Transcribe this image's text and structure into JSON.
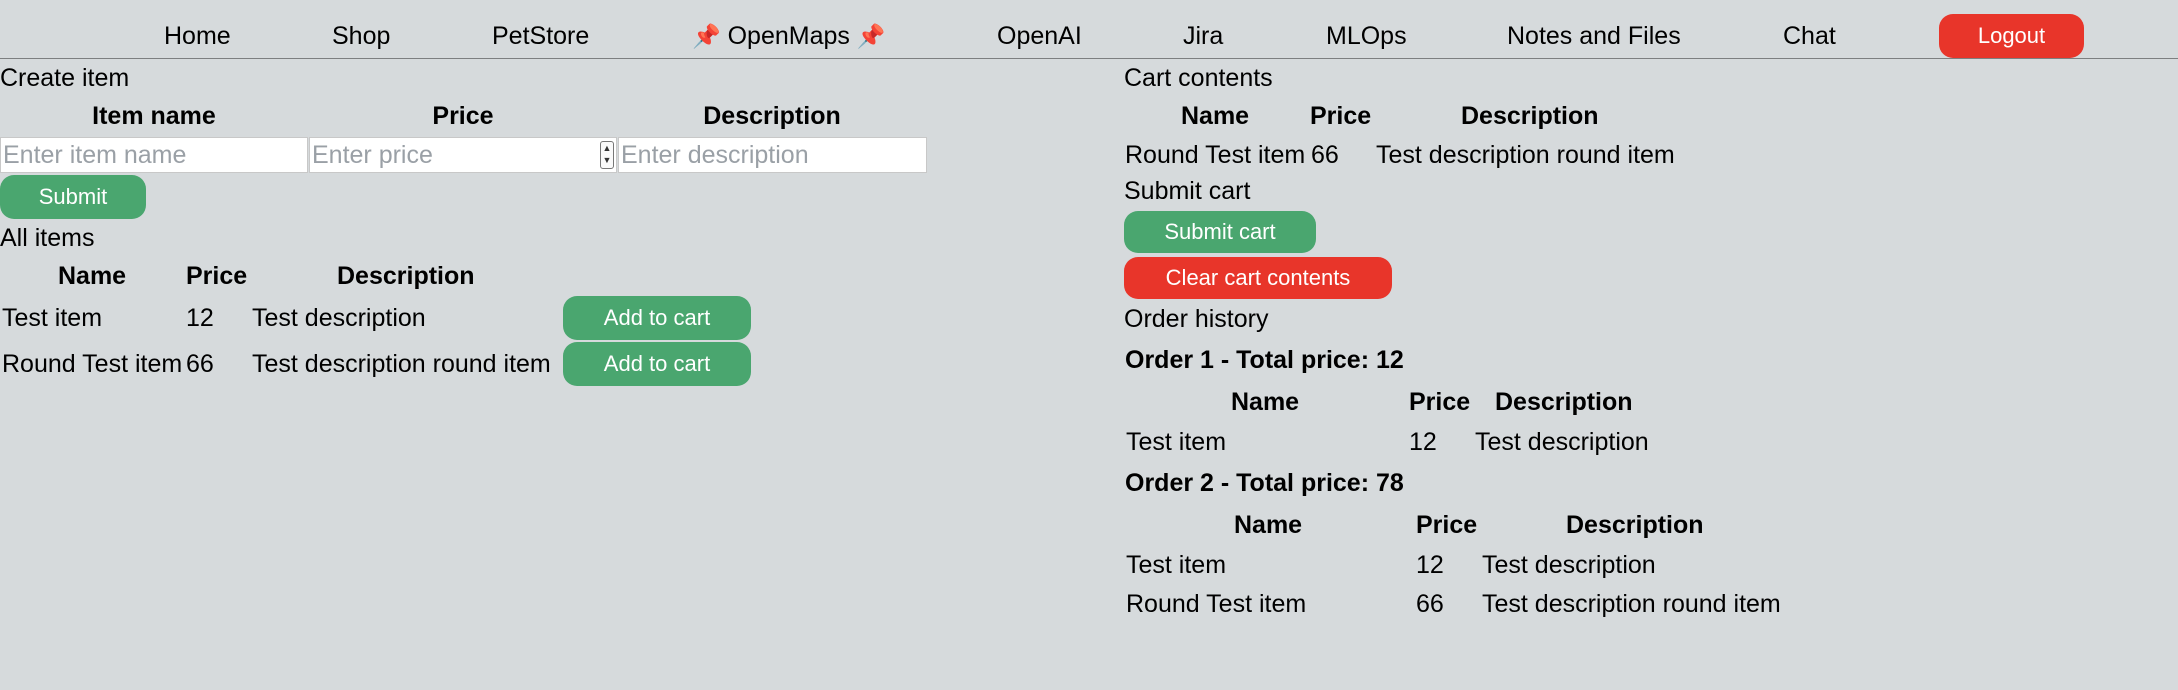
{
  "nav": {
    "items": [
      "Home",
      "Shop",
      "PetStore",
      "OpenMaps",
      "OpenAI",
      "Jira",
      "MLOps",
      "Notes and Files",
      "Chat"
    ],
    "pin_icon": "📌",
    "logout_label": "Logout",
    "logout_color": "#e8352a"
  },
  "create_item": {
    "title": "Create item",
    "headers": [
      "Item name",
      "Price",
      "Description"
    ],
    "placeholders": [
      "Enter item name",
      "Enter price",
      "Enter description"
    ],
    "submit_label": "Submit"
  },
  "all_items": {
    "title": "All items",
    "headers": [
      "Name",
      "Price",
      "Description"
    ],
    "rows": [
      {
        "name": "Test item",
        "price": "12",
        "description": "Test description",
        "action": "Add to cart"
      },
      {
        "name": "Round Test item",
        "price": "66",
        "description": "Test description round item",
        "action": "Add to cart"
      }
    ]
  },
  "cart": {
    "title": "Cart contents",
    "headers": [
      "Name",
      "Price",
      "Description"
    ],
    "rows": [
      {
        "name": "Round Test item",
        "price": "66",
        "description": "Test description round item"
      }
    ],
    "submit_title": "Submit cart",
    "submit_label": "Submit cart",
    "clear_label": "Clear cart contents"
  },
  "order_history": {
    "title": "Order history",
    "orders": [
      {
        "title": "Order 1 - Total price: 12",
        "headers": [
          "Name",
          "Price",
          "Description"
        ],
        "rows": [
          {
            "name": "Test item",
            "price": "12",
            "description": "Test description"
          }
        ]
      },
      {
        "title": "Order 2 - Total price: 78",
        "headers": [
          "Name",
          "Price",
          "Description"
        ],
        "rows": [
          {
            "name": "Test item",
            "price": "12",
            "description": "Test description"
          },
          {
            "name": "Round Test item",
            "price": "66",
            "description": "Test description round item"
          }
        ]
      }
    ]
  },
  "colors": {
    "background": "#d6dadc",
    "green_button": "#4aa66f",
    "red_button": "#e8352a"
  }
}
